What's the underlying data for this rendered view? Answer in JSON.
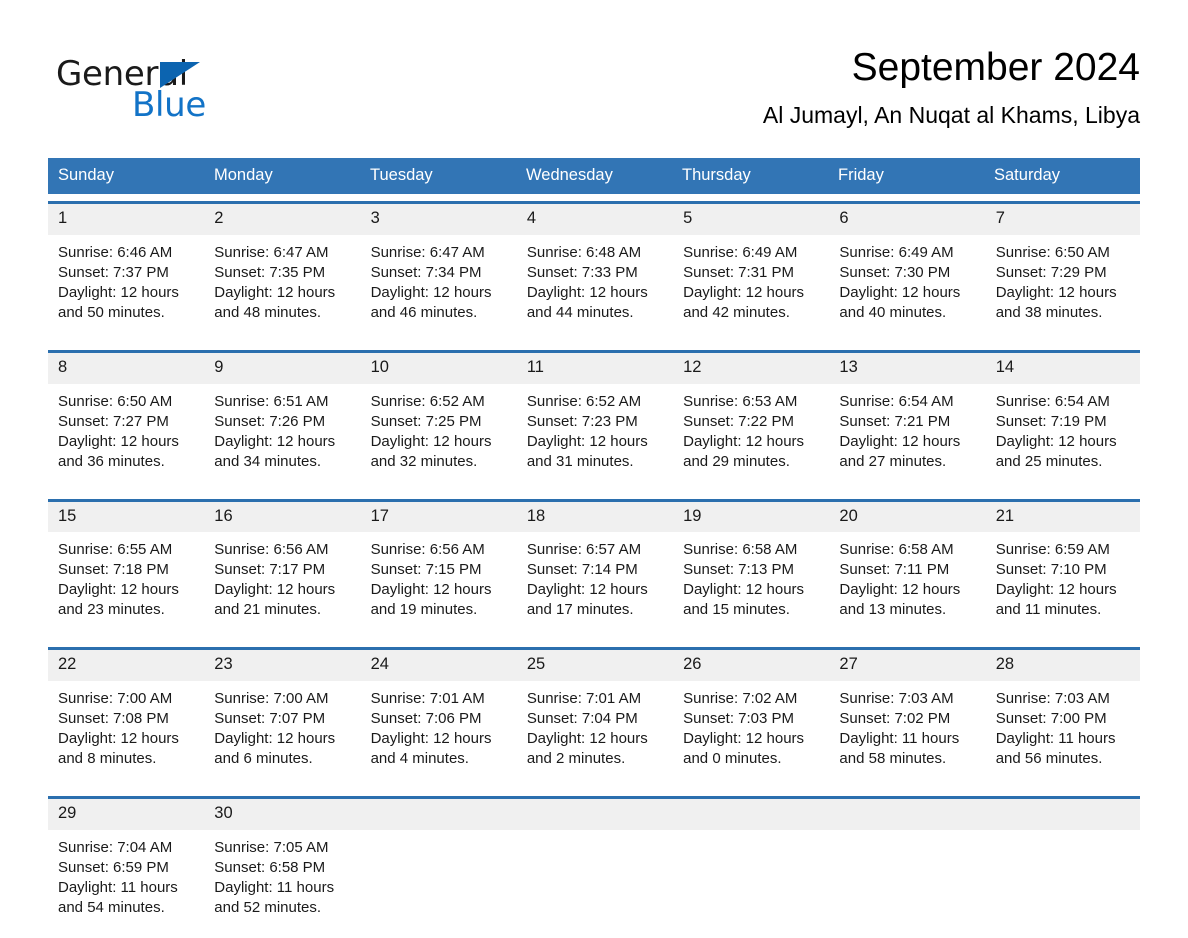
{
  "logo": {
    "word_one": "General",
    "word_two": "Blue",
    "triangle_icon": "triangle-icon",
    "accent_color": "#0c64b0",
    "blue_text_color": "#1273c7"
  },
  "header": {
    "title": "September 2024",
    "subtitle": "Al Jumayl, An Nuqat al Khams, Libya"
  },
  "theme": {
    "header_blue": "#3275b5",
    "row_divider_blue": "#2b6fae",
    "date_band_gray": "#f0f0f0"
  },
  "calendar": {
    "weekday_headers": [
      "Sunday",
      "Monday",
      "Tuesday",
      "Wednesday",
      "Thursday",
      "Friday",
      "Saturday"
    ],
    "weeks": [
      {
        "days": [
          {
            "date": "1",
            "sunrise": "Sunrise: 6:46 AM",
            "sunset": "Sunset: 7:37 PM",
            "daylight_line1": "Daylight: 12 hours",
            "daylight_line2": "and 50 minutes."
          },
          {
            "date": "2",
            "sunrise": "Sunrise: 6:47 AM",
            "sunset": "Sunset: 7:35 PM",
            "daylight_line1": "Daylight: 12 hours",
            "daylight_line2": "and 48 minutes."
          },
          {
            "date": "3",
            "sunrise": "Sunrise: 6:47 AM",
            "sunset": "Sunset: 7:34 PM",
            "daylight_line1": "Daylight: 12 hours",
            "daylight_line2": "and 46 minutes."
          },
          {
            "date": "4",
            "sunrise": "Sunrise: 6:48 AM",
            "sunset": "Sunset: 7:33 PM",
            "daylight_line1": "Daylight: 12 hours",
            "daylight_line2": "and 44 minutes."
          },
          {
            "date": "5",
            "sunrise": "Sunrise: 6:49 AM",
            "sunset": "Sunset: 7:31 PM",
            "daylight_line1": "Daylight: 12 hours",
            "daylight_line2": "and 42 minutes."
          },
          {
            "date": "6",
            "sunrise": "Sunrise: 6:49 AM",
            "sunset": "Sunset: 7:30 PM",
            "daylight_line1": "Daylight: 12 hours",
            "daylight_line2": "and 40 minutes."
          },
          {
            "date": "7",
            "sunrise": "Sunrise: 6:50 AM",
            "sunset": "Sunset: 7:29 PM",
            "daylight_line1": "Daylight: 12 hours",
            "daylight_line2": "and 38 minutes."
          }
        ]
      },
      {
        "days": [
          {
            "date": "8",
            "sunrise": "Sunrise: 6:50 AM",
            "sunset": "Sunset: 7:27 PM",
            "daylight_line1": "Daylight: 12 hours",
            "daylight_line2": "and 36 minutes."
          },
          {
            "date": "9",
            "sunrise": "Sunrise: 6:51 AM",
            "sunset": "Sunset: 7:26 PM",
            "daylight_line1": "Daylight: 12 hours",
            "daylight_line2": "and 34 minutes."
          },
          {
            "date": "10",
            "sunrise": "Sunrise: 6:52 AM",
            "sunset": "Sunset: 7:25 PM",
            "daylight_line1": "Daylight: 12 hours",
            "daylight_line2": "and 32 minutes."
          },
          {
            "date": "11",
            "sunrise": "Sunrise: 6:52 AM",
            "sunset": "Sunset: 7:23 PM",
            "daylight_line1": "Daylight: 12 hours",
            "daylight_line2": "and 31 minutes."
          },
          {
            "date": "12",
            "sunrise": "Sunrise: 6:53 AM",
            "sunset": "Sunset: 7:22 PM",
            "daylight_line1": "Daylight: 12 hours",
            "daylight_line2": "and 29 minutes."
          },
          {
            "date": "13",
            "sunrise": "Sunrise: 6:54 AM",
            "sunset": "Sunset: 7:21 PM",
            "daylight_line1": "Daylight: 12 hours",
            "daylight_line2": "and 27 minutes."
          },
          {
            "date": "14",
            "sunrise": "Sunrise: 6:54 AM",
            "sunset": "Sunset: 7:19 PM",
            "daylight_line1": "Daylight: 12 hours",
            "daylight_line2": "and 25 minutes."
          }
        ]
      },
      {
        "days": [
          {
            "date": "15",
            "sunrise": "Sunrise: 6:55 AM",
            "sunset": "Sunset: 7:18 PM",
            "daylight_line1": "Daylight: 12 hours",
            "daylight_line2": "and 23 minutes."
          },
          {
            "date": "16",
            "sunrise": "Sunrise: 6:56 AM",
            "sunset": "Sunset: 7:17 PM",
            "daylight_line1": "Daylight: 12 hours",
            "daylight_line2": "and 21 minutes."
          },
          {
            "date": "17",
            "sunrise": "Sunrise: 6:56 AM",
            "sunset": "Sunset: 7:15 PM",
            "daylight_line1": "Daylight: 12 hours",
            "daylight_line2": "and 19 minutes."
          },
          {
            "date": "18",
            "sunrise": "Sunrise: 6:57 AM",
            "sunset": "Sunset: 7:14 PM",
            "daylight_line1": "Daylight: 12 hours",
            "daylight_line2": "and 17 minutes."
          },
          {
            "date": "19",
            "sunrise": "Sunrise: 6:58 AM",
            "sunset": "Sunset: 7:13 PM",
            "daylight_line1": "Daylight: 12 hours",
            "daylight_line2": "and 15 minutes."
          },
          {
            "date": "20",
            "sunrise": "Sunrise: 6:58 AM",
            "sunset": "Sunset: 7:11 PM",
            "daylight_line1": "Daylight: 12 hours",
            "daylight_line2": "and 13 minutes."
          },
          {
            "date": "21",
            "sunrise": "Sunrise: 6:59 AM",
            "sunset": "Sunset: 7:10 PM",
            "daylight_line1": "Daylight: 12 hours",
            "daylight_line2": "and 11 minutes."
          }
        ]
      },
      {
        "days": [
          {
            "date": "22",
            "sunrise": "Sunrise: 7:00 AM",
            "sunset": "Sunset: 7:08 PM",
            "daylight_line1": "Daylight: 12 hours",
            "daylight_line2": "and 8 minutes."
          },
          {
            "date": "23",
            "sunrise": "Sunrise: 7:00 AM",
            "sunset": "Sunset: 7:07 PM",
            "daylight_line1": "Daylight: 12 hours",
            "daylight_line2": "and 6 minutes."
          },
          {
            "date": "24",
            "sunrise": "Sunrise: 7:01 AM",
            "sunset": "Sunset: 7:06 PM",
            "daylight_line1": "Daylight: 12 hours",
            "daylight_line2": "and 4 minutes."
          },
          {
            "date": "25",
            "sunrise": "Sunrise: 7:01 AM",
            "sunset": "Sunset: 7:04 PM",
            "daylight_line1": "Daylight: 12 hours",
            "daylight_line2": "and 2 minutes."
          },
          {
            "date": "26",
            "sunrise": "Sunrise: 7:02 AM",
            "sunset": "Sunset: 7:03 PM",
            "daylight_line1": "Daylight: 12 hours",
            "daylight_line2": "and 0 minutes."
          },
          {
            "date": "27",
            "sunrise": "Sunrise: 7:03 AM",
            "sunset": "Sunset: 7:02 PM",
            "daylight_line1": "Daylight: 11 hours",
            "daylight_line2": "and 58 minutes."
          },
          {
            "date": "28",
            "sunrise": "Sunrise: 7:03 AM",
            "sunset": "Sunset: 7:00 PM",
            "daylight_line1": "Daylight: 11 hours",
            "daylight_line2": "and 56 minutes."
          }
        ]
      },
      {
        "days": [
          {
            "date": "29",
            "sunrise": "Sunrise: 7:04 AM",
            "sunset": "Sunset: 6:59 PM",
            "daylight_line1": "Daylight: 11 hours",
            "daylight_line2": "and 54 minutes."
          },
          {
            "date": "30",
            "sunrise": "Sunrise: 7:05 AM",
            "sunset": "Sunset: 6:58 PM",
            "daylight_line1": "Daylight: 11 hours",
            "daylight_line2": "and 52 minutes."
          },
          {
            "date": "",
            "sunrise": "",
            "sunset": "",
            "daylight_line1": "",
            "daylight_line2": ""
          },
          {
            "date": "",
            "sunrise": "",
            "sunset": "",
            "daylight_line1": "",
            "daylight_line2": ""
          },
          {
            "date": "",
            "sunrise": "",
            "sunset": "",
            "daylight_line1": "",
            "daylight_line2": ""
          },
          {
            "date": "",
            "sunrise": "",
            "sunset": "",
            "daylight_line1": "",
            "daylight_line2": ""
          },
          {
            "date": "",
            "sunrise": "",
            "sunset": "",
            "daylight_line1": "",
            "daylight_line2": ""
          }
        ]
      }
    ]
  }
}
